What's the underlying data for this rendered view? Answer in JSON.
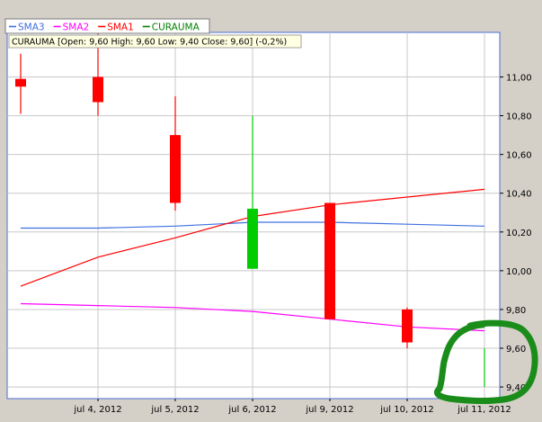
{
  "colors": {
    "frame_bg": "#d4d0c8",
    "plot_bg": "#ffffff",
    "plot_border": "#4a6fd6",
    "grid": "#c8c8c8",
    "sma3": "#3f6fe0",
    "sma2": "#ff00ff",
    "sma1": "#ff0000",
    "curauma": "#008000",
    "candle_down": "#ff0000",
    "candle_up": "#00cc00",
    "info_bg": "#ffffe1",
    "scribble": "#1a8c1a"
  },
  "legend": {
    "items": [
      {
        "label": "SMA3",
        "color": "#3f6fe0"
      },
      {
        "label": "SMA2",
        "color": "#ff00ff"
      },
      {
        "label": "SMA1",
        "color": "#ff0000"
      },
      {
        "label": "CURAUMA",
        "color": "#008000"
      }
    ]
  },
  "info_bar": {
    "text": "CURAUMA [Open: 9,60  High: 9,60  Low: 9,40  Close: 9,60] (-0,2%)"
  },
  "chart_data": {
    "type": "candlestick",
    "series_name": "CURAUMA",
    "ylim": [
      9.34,
      11.23
    ],
    "y_ticks": [
      "9,40",
      "9,60",
      "9,80",
      "10,00",
      "10,20",
      "10,40",
      "10,60",
      "10,80",
      "11,00"
    ],
    "y_tick_values": [
      9.4,
      9.6,
      9.8,
      10.0,
      10.2,
      10.4,
      10.6,
      10.8,
      11.0
    ],
    "x_labels": [
      "jul 4, 2012",
      "jul 5, 2012",
      "jul 6, 2012",
      "jul 9, 2012",
      "jul 10, 2012",
      "jul 11, 2012"
    ],
    "x_label_indices": [
      1,
      2,
      3,
      4,
      5,
      6
    ],
    "candles": [
      {
        "open": 10.99,
        "high": 11.12,
        "low": 10.81,
        "close": 10.95
      },
      {
        "open": 11.0,
        "high": 11.23,
        "low": 10.8,
        "close": 10.87
      },
      {
        "open": 10.7,
        "high": 10.9,
        "low": 10.31,
        "close": 10.35
      },
      {
        "open": 10.01,
        "high": 10.8,
        "low": 10.01,
        "close": 10.32
      },
      {
        "open": 10.35,
        "high": 10.35,
        "low": 9.75,
        "close": 9.75
      },
      {
        "open": 9.8,
        "high": 9.81,
        "low": 9.6,
        "close": 9.63
      },
      {
        "open": 9.6,
        "high": 9.6,
        "low": 9.4,
        "close": 9.6
      }
    ],
    "sma_lines": [
      {
        "name": "SMA3",
        "color": "#3f6fe0",
        "values": [
          10.22,
          10.22,
          10.23,
          10.25,
          10.25,
          10.24,
          10.23
        ]
      },
      {
        "name": "SMA2",
        "color": "#ff00ff",
        "values": [
          9.83,
          9.82,
          9.81,
          9.79,
          9.75,
          9.71,
          9.69
        ]
      },
      {
        "name": "SMA1",
        "color": "#ff0000",
        "values": [
          9.92,
          10.07,
          10.17,
          10.28,
          10.34,
          10.38,
          10.42
        ]
      }
    ],
    "grid": true
  }
}
